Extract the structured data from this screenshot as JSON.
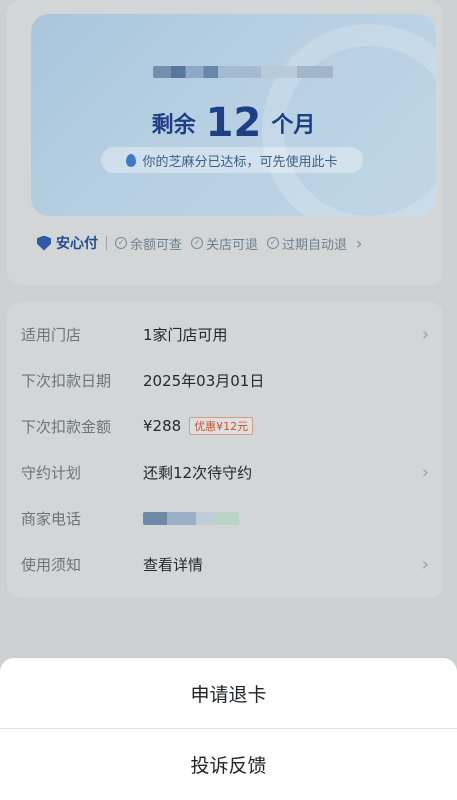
{
  "card": {
    "remain_prefix": "剩余",
    "remain_number": "12",
    "remain_suffix": "个月",
    "notice": "你的芝麻分已达标，可先使用此卡"
  },
  "assurance": {
    "brand": "安心付",
    "features": [
      "余额可查",
      "关店可退",
      "过期自动退"
    ]
  },
  "details": [
    {
      "label": "适用门店",
      "value": "1家门店可用",
      "chevron": true
    },
    {
      "label": "下次扣款日期",
      "value": "2025年03月01日",
      "chevron": false
    },
    {
      "label": "下次扣款金额",
      "value": "¥288",
      "badge": "优惠¥12元",
      "chevron": false
    },
    {
      "label": "守约计划",
      "value": "还剩12次待守约",
      "chevron": true
    },
    {
      "label": "商家电话",
      "value": "",
      "chevron": false
    },
    {
      "label": "使用须知",
      "value": "查看详情",
      "chevron": true
    }
  ],
  "sheet": {
    "refund_label": "申请退卡",
    "complain_label": "投诉反馈"
  }
}
